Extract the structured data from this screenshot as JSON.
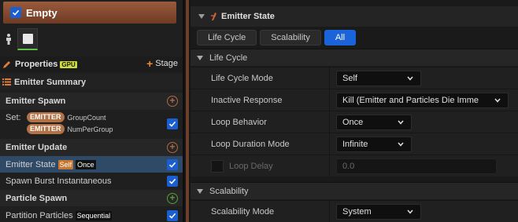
{
  "emitter": {
    "name": "Empty"
  },
  "left": {
    "properties": {
      "label": "Properties",
      "badge": "GPU",
      "stage_label": "Stage"
    },
    "summary_label": "Emitter Summary",
    "emitter_spawn": {
      "label": "Emitter Spawn",
      "set_label": "Set:",
      "entries": [
        {
          "pill": "EMITTER",
          "value": "GroupCount"
        },
        {
          "pill": "EMITTER",
          "value": "NumPerGroup"
        }
      ]
    },
    "emitter_update": {
      "label": "Emitter Update",
      "items": [
        {
          "label": "Emitter State",
          "tags": [
            "Self",
            "Once"
          ]
        },
        {
          "label": "Spawn Burst Instantaneous"
        }
      ]
    },
    "particle_spawn": {
      "label": "Particle Spawn",
      "items": [
        {
          "label": "Partition Particles",
          "tag": "Sequential"
        }
      ]
    }
  },
  "right": {
    "title": "Emitter State",
    "tabs": [
      {
        "label": "Life Cycle",
        "active": false
      },
      {
        "label": "Scalability",
        "active": false
      },
      {
        "label": "All",
        "active": true
      }
    ],
    "life_cycle": {
      "label": "Life Cycle",
      "rows": [
        {
          "label": "Life Cycle Mode",
          "value": "Self"
        },
        {
          "label": "Inactive Response",
          "value": "Kill (Emitter and Particles Die Imme"
        },
        {
          "label": "Loop Behavior",
          "value": "Once"
        },
        {
          "label": "Loop Duration Mode",
          "value": "Infinite"
        },
        {
          "label": "Loop Delay",
          "value": "0.0"
        }
      ]
    },
    "scalability": {
      "label": "Scalability",
      "rows": [
        {
          "label": "Scalability Mode",
          "value": "System"
        }
      ]
    }
  },
  "colors": {
    "accent": "#1a63d8",
    "emitter_header": "#8a4e33",
    "pill": "#b37246",
    "gpu_badge": "#cddc39"
  }
}
